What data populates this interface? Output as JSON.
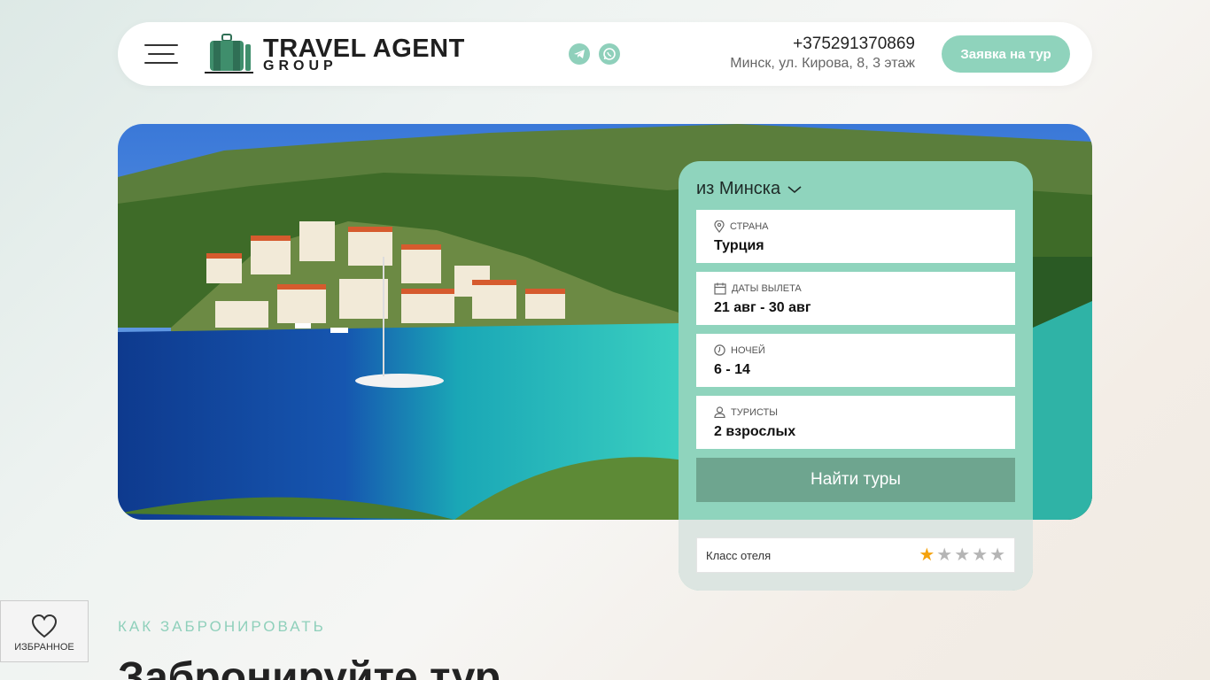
{
  "header": {
    "logo_title": "TRAVEL AGENT",
    "logo_subtitle": "GROUP",
    "phone": "+375291370869",
    "address": "Минск, ул. Кирова, 8, 3 этаж",
    "cta_label": "Заявка на тур",
    "social": [
      "telegram-icon",
      "whatsapp-icon"
    ]
  },
  "search": {
    "from_label": "из Минска",
    "fields": [
      {
        "label": "Страна",
        "value": "Турция",
        "icon": "location-pin-icon"
      },
      {
        "label": "Даты вылета",
        "value": "21 авг - 30 авг",
        "icon": "calendar-icon"
      },
      {
        "label": "Ночей",
        "value": "6 - 14",
        "icon": "clock-icon"
      },
      {
        "label": "Туристы",
        "value": "2 взрослых",
        "icon": "user-icon"
      }
    ],
    "button_label": "Найти туры",
    "hotel_class_label": "Класс отеля",
    "hotel_class_selected": 1,
    "hotel_class_max": 5
  },
  "favorites": {
    "label": "ИЗБРАННОЕ"
  },
  "section": {
    "eyebrow": "КАК ЗАБРОНИРОВАТЬ",
    "title": "Забронируйте тур"
  },
  "colors": {
    "accent": "#8fd4bd",
    "button": "#6ea58f",
    "star_active": "#f4a20d"
  }
}
